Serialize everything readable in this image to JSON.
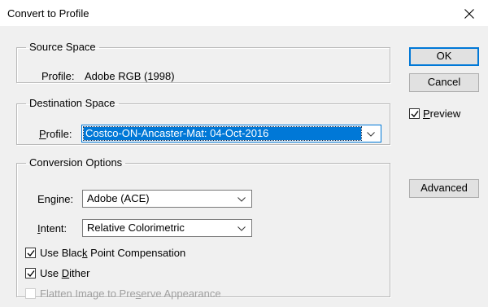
{
  "dialog": {
    "title": "Convert to Profile",
    "close_symbol": "×"
  },
  "source_space": {
    "legend": "Source Space",
    "profile_label": "Profile:",
    "profile_value": "Adobe RGB (1998)"
  },
  "destination_space": {
    "legend": "Destination Space",
    "profile_label": "Profile:",
    "profile_value": "Costco-ON-Ancaster-Mat: 04-Oct-2016"
  },
  "conversion_options": {
    "legend": "Conversion Options",
    "engine_label": "Engine:",
    "engine_value": "Adobe (ACE)",
    "intent_label": "Intent:",
    "intent_value": "Relative Colorimetric",
    "black_point": {
      "label": "Use Black Point Compensation",
      "checked": true
    },
    "dither": {
      "label": "Use Dither",
      "checked": true
    },
    "flatten": {
      "label": "Flatten Image to Preserve Appearance",
      "checked": false,
      "enabled": false
    }
  },
  "buttons": {
    "ok": "OK",
    "cancel": "Cancel",
    "advanced": "Advanced"
  },
  "preview": {
    "label": "Preview",
    "checked": true
  },
  "colors": {
    "accent": "#0078d7",
    "dialog_bg": "#f0f0f0",
    "disabled_text": "#a0a0a0"
  }
}
